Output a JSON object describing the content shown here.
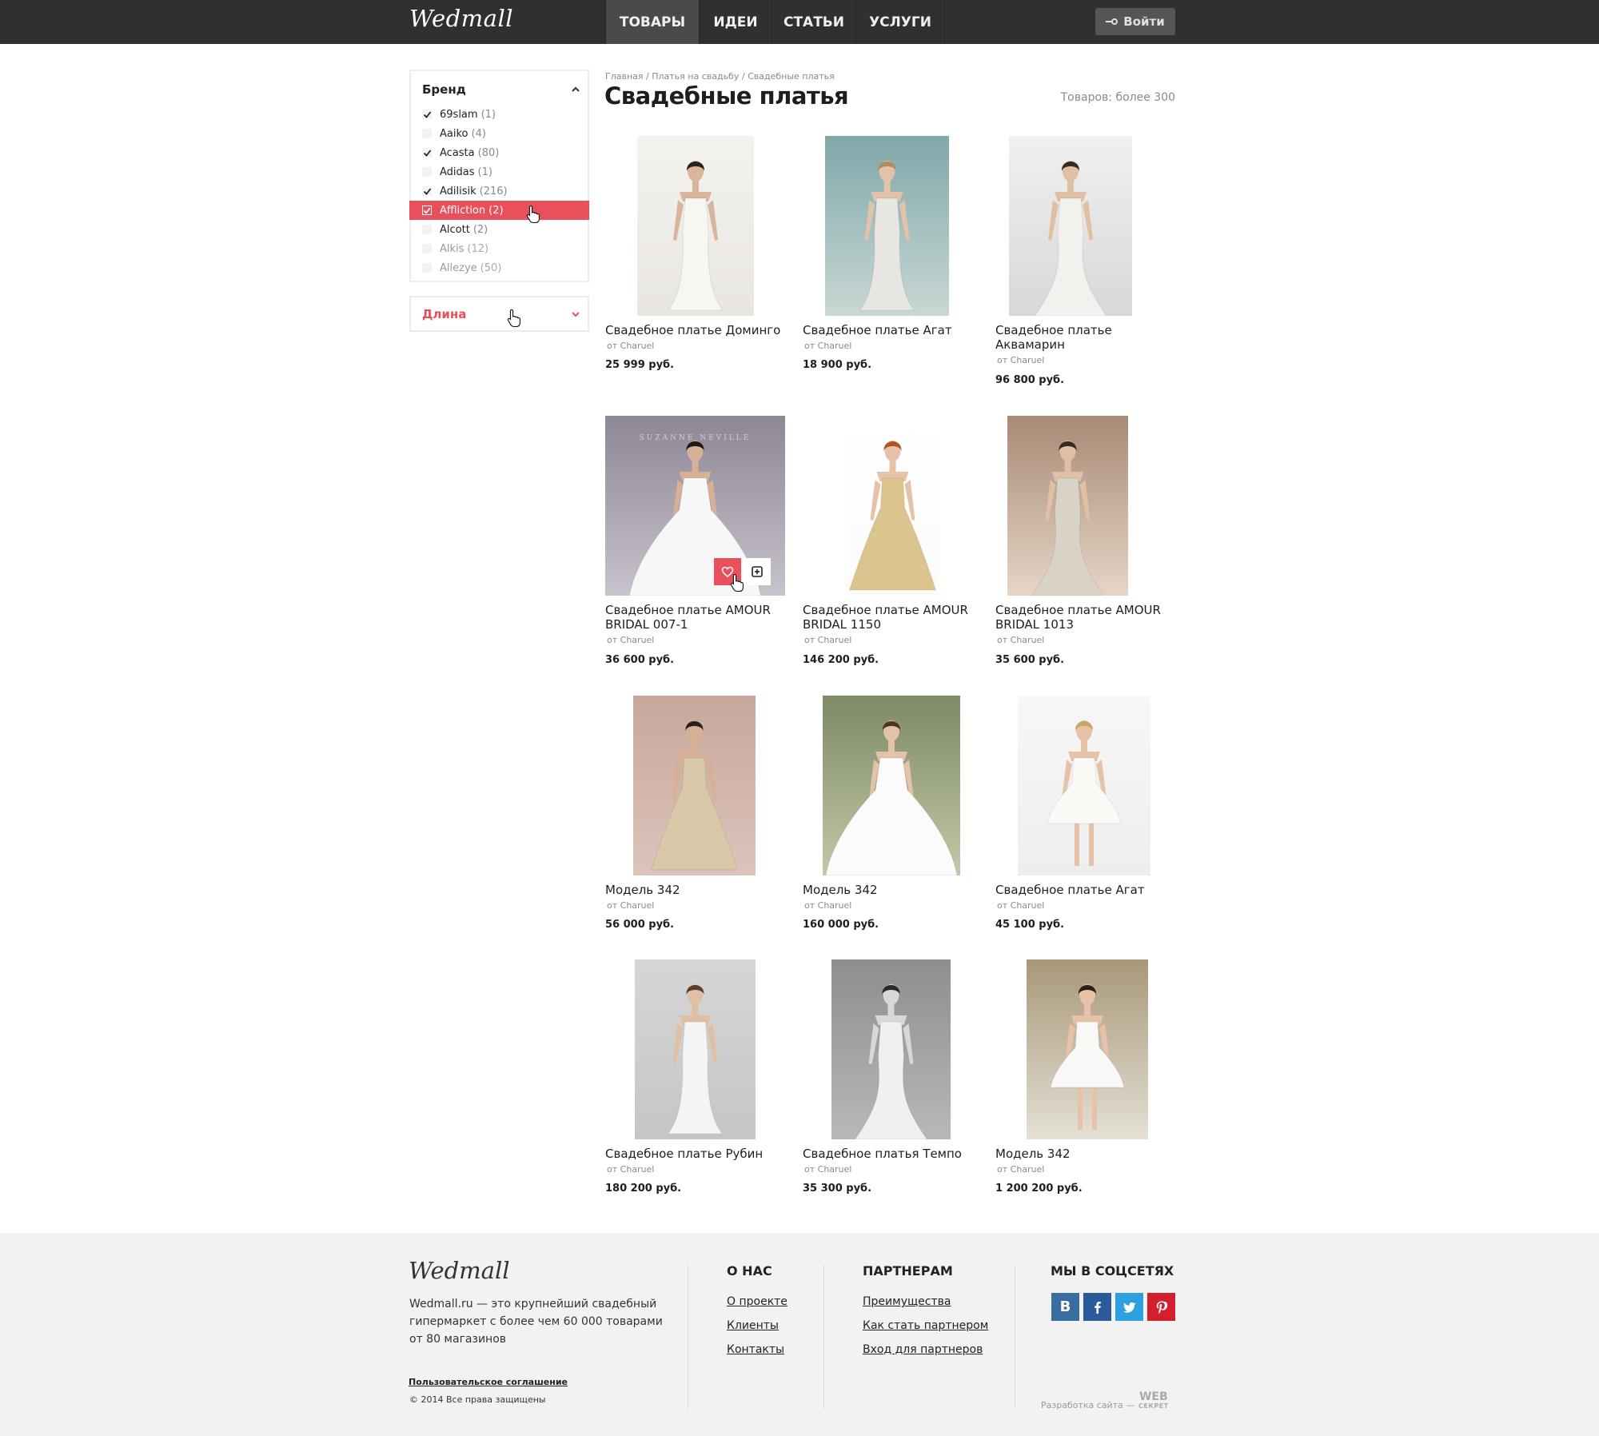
{
  "header": {
    "logo": "Wedmall",
    "nav": [
      {
        "label": "ТОВАРЫ",
        "active": true
      },
      {
        "label": "ИДЕИ",
        "active": false
      },
      {
        "label": "СТАТЬИ",
        "active": false
      },
      {
        "label": "УСЛУГИ",
        "active": false
      }
    ],
    "login_label": "Войти"
  },
  "filters": {
    "brand": {
      "title": "Бренд",
      "items": [
        {
          "name": "69slam",
          "count": "(1)",
          "checked": true
        },
        {
          "name": "Aaiko",
          "count": "(4)",
          "checked": false
        },
        {
          "name": "Acasta",
          "count": "(80)",
          "checked": true
        },
        {
          "name": "Adidas",
          "count": "(1)",
          "checked": false
        },
        {
          "name": "Adilisik",
          "count": "(216)",
          "checked": true
        },
        {
          "name": "Affliction",
          "count": "(2)",
          "checked": true,
          "hover": true
        },
        {
          "name": "Alcott",
          "count": "(2)",
          "checked": false
        },
        {
          "name": "Alkis",
          "count": "(12)",
          "checked": false
        },
        {
          "name": "Allezye",
          "count": "(50)",
          "checked": false
        }
      ]
    },
    "length": {
      "title": "Длина"
    }
  },
  "content": {
    "breadcrumb": [
      "Главная",
      "Платья на свадьбу",
      "Свадебные платья"
    ],
    "title": "Свадебные платья",
    "count": "Товаров: более 300",
    "products": [
      {
        "name": "Свадебное платье Доминго",
        "brand": "от Charuel",
        "price": "25 999 руб."
      },
      {
        "name": "Свадебное платье Агат",
        "brand": "от Charuel",
        "price": "18 900 руб."
      },
      {
        "name": "Свадебное платье Аквамарин",
        "brand": "от Charuel",
        "price": "96 800 руб."
      },
      {
        "name": "Свадебное платье AMOUR BRIDAL 007-1",
        "brand": "от Charuel",
        "price": "36 600 руб.",
        "image_text": "SUZANNE NEVILLE"
      },
      {
        "name": "Свадебное платье AMOUR BRIDAL 1150",
        "brand": "от Charuel",
        "price": "146 200 руб."
      },
      {
        "name": "Свадебное платье AMOUR BRIDAL 1013",
        "brand": "от Charuel",
        "price": "35 600 руб."
      },
      {
        "name": "Модель 342",
        "brand": "от Charuel",
        "price": "56 000 руб."
      },
      {
        "name": "Модель 342",
        "brand": "от Charuel",
        "price": "160 000 руб."
      },
      {
        "name": "Свадебное платье Агат",
        "brand": "от Charuel",
        "price": "45 100 руб."
      },
      {
        "name": "Свадебное платье Рубин",
        "brand": "от Charuel",
        "price": "180 200 руб."
      },
      {
        "name": "Свадебное платья Темпо",
        "brand": "от Charuel",
        "price": "35 300 руб."
      },
      {
        "name": "Модель 342",
        "brand": "от Charuel",
        "price": "1 200 200 руб."
      }
    ]
  },
  "footer": {
    "logo": "Wedmall",
    "about": "Wedmall.ru — это крупнейший свадебный гипермаркет с более чем 60 000 товарами от 80 магазинов",
    "agreement": "Пользовательское соглашение",
    "copyright": "© 2014 Все права защищены",
    "col_about": {
      "title": "О НАС",
      "links": [
        "О проекте",
        "Клиенты",
        "Контакты"
      ]
    },
    "col_partners": {
      "title": "ПАРТНЕРАМ",
      "links": [
        "Преимущества",
        "Как стать партнером",
        "Вход для партнеров"
      ]
    },
    "col_social": {
      "title": "МЫ В СОЦСЕТЯХ",
      "vk_label": "B"
    },
    "developer": "Разработка сайта —",
    "developer_logo": "WEB",
    "developer_logo_sub": "СЕКРЕТ"
  },
  "colors": {
    "accent": "#e8505b",
    "topbar": "#303030",
    "vk": "#3a6da0",
    "facebook": "#2a5a9a",
    "twitter": "#2e9fdf",
    "pinterest": "#d4202e"
  }
}
